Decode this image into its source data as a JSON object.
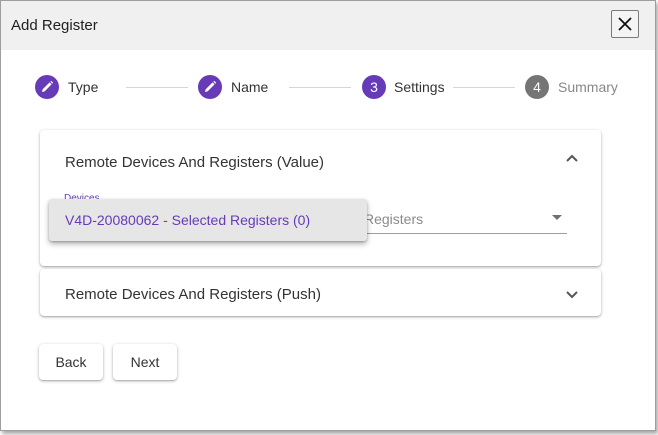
{
  "dialog": {
    "title": "Add Register",
    "close_icon": "close-icon"
  },
  "stepper": {
    "steps": [
      {
        "label": "Type",
        "marker": "",
        "icon": "pencil-icon",
        "state": "completed"
      },
      {
        "label": "Name",
        "marker": "",
        "icon": "pencil-icon",
        "state": "completed"
      },
      {
        "label": "Settings",
        "marker": "3",
        "state": "active"
      },
      {
        "label": "Summary",
        "marker": "4",
        "state": "inactive"
      }
    ]
  },
  "panels": {
    "value": {
      "title": "Remote Devices And Registers (Value)",
      "expanded": true,
      "icon": "chevron-up-icon",
      "devices_label": "Devices",
      "select_text": "Registers",
      "dropdown_options": [
        "V4D-20080062 - Selected Registers (0)"
      ]
    },
    "push": {
      "title": "Remote Devices And Registers (Push)",
      "expanded": false,
      "icon": "chevron-down-icon"
    }
  },
  "actions": {
    "back_label": "Back",
    "next_label": "Next"
  },
  "colors": {
    "accent": "#673ab7",
    "inactive_step": "#757575",
    "titlebar": "#f0f0f0"
  }
}
